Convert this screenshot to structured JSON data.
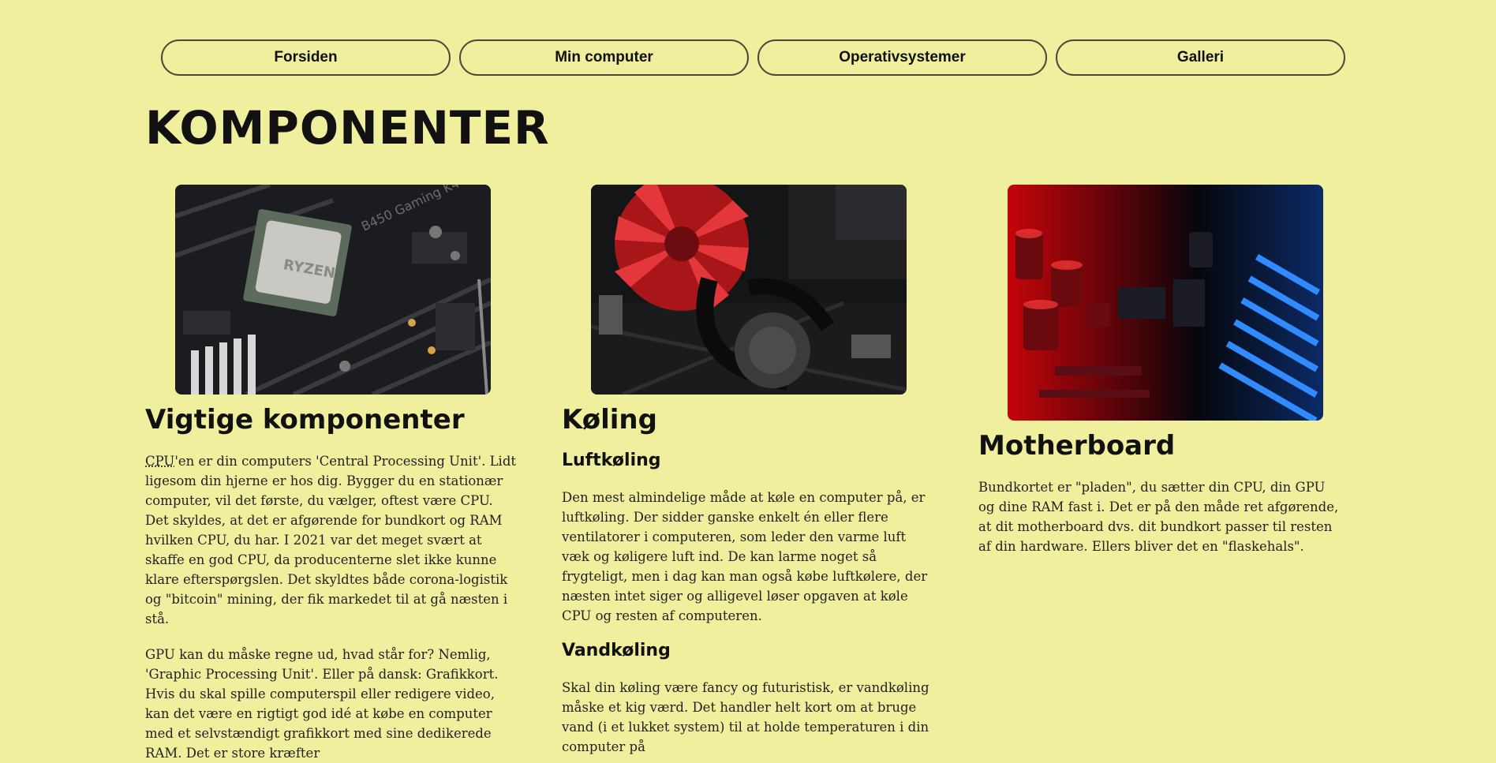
{
  "nav": {
    "items": [
      {
        "label": "Forsiden"
      },
      {
        "label": "Min computer"
      },
      {
        "label": "Operativsystemer"
      },
      {
        "label": "Galleri"
      }
    ]
  },
  "page": {
    "title": "KOMPONENTER"
  },
  "columns": {
    "cpu": {
      "image_icon": "cpu-motherboard-photo",
      "heading": "Vigtige komponenter",
      "abbr": "CPU",
      "paragraph1_rest": "'en er din computers 'Central Processing Unit'. Lidt ligesom din hjerne er hos dig. Bygger du en stationær computer, vil det første, du vælger, oftest være CPU. Det skyldes, at det er afgørende for bundkort og RAM hvilken CPU, du har. I 2021 var det meget svært at skaffe en god CPU, da producenterne slet ikke kunne klare efterspørgslen. Det skyldtes både corona-logistik og \"bitcoin\" mining, der fik markedet til at gå næsten i stå.",
      "paragraph2": "GPU kan du måske regne ud, hvad står for? Nemlig, 'Graphic Processing Unit'. Eller på dansk: Grafikkort. Hvis du skal spille computerspil eller redigere video, kan det være en rigtigt god idé at købe en computer med et selvstændigt grafikkort med sine dedikerede RAM. Det er store kræfter"
    },
    "cooling": {
      "image_icon": "cpu-cooler-photo",
      "heading": "Køling",
      "sub1": "Luftkøling",
      "p1": "Den mest almindelige måde at køle en computer på, er luftkøling. Der sidder ganske enkelt én eller flere ventilatorer i computeren, som leder den varme luft væk og køligere luft ind. De kan larme noget så frygteligt, men i dag kan man også købe luftkølere, der næsten intet siger og alligevel løser opgaven at køle CPU og resten af computeren.",
      "sub2": "Vandkøling",
      "p2": "Skal din køling være fancy og futuristisk, er vandkøling måske et kig værd. Det handler helt kort om at bruge vand (i et lukket system) til at holde temperaturen i din computer på"
    },
    "motherboard": {
      "image_icon": "motherboard-photo",
      "heading": "Motherboard",
      "p1": "Bundkortet er \"pladen\", du sætter din CPU, din GPU og dine RAM fast i. Det er på den måde ret afgørende, at dit motherboard dvs. dit bundkort passer til resten af din hardware. Ellers bliver det en \"flaskehals\"."
    }
  }
}
